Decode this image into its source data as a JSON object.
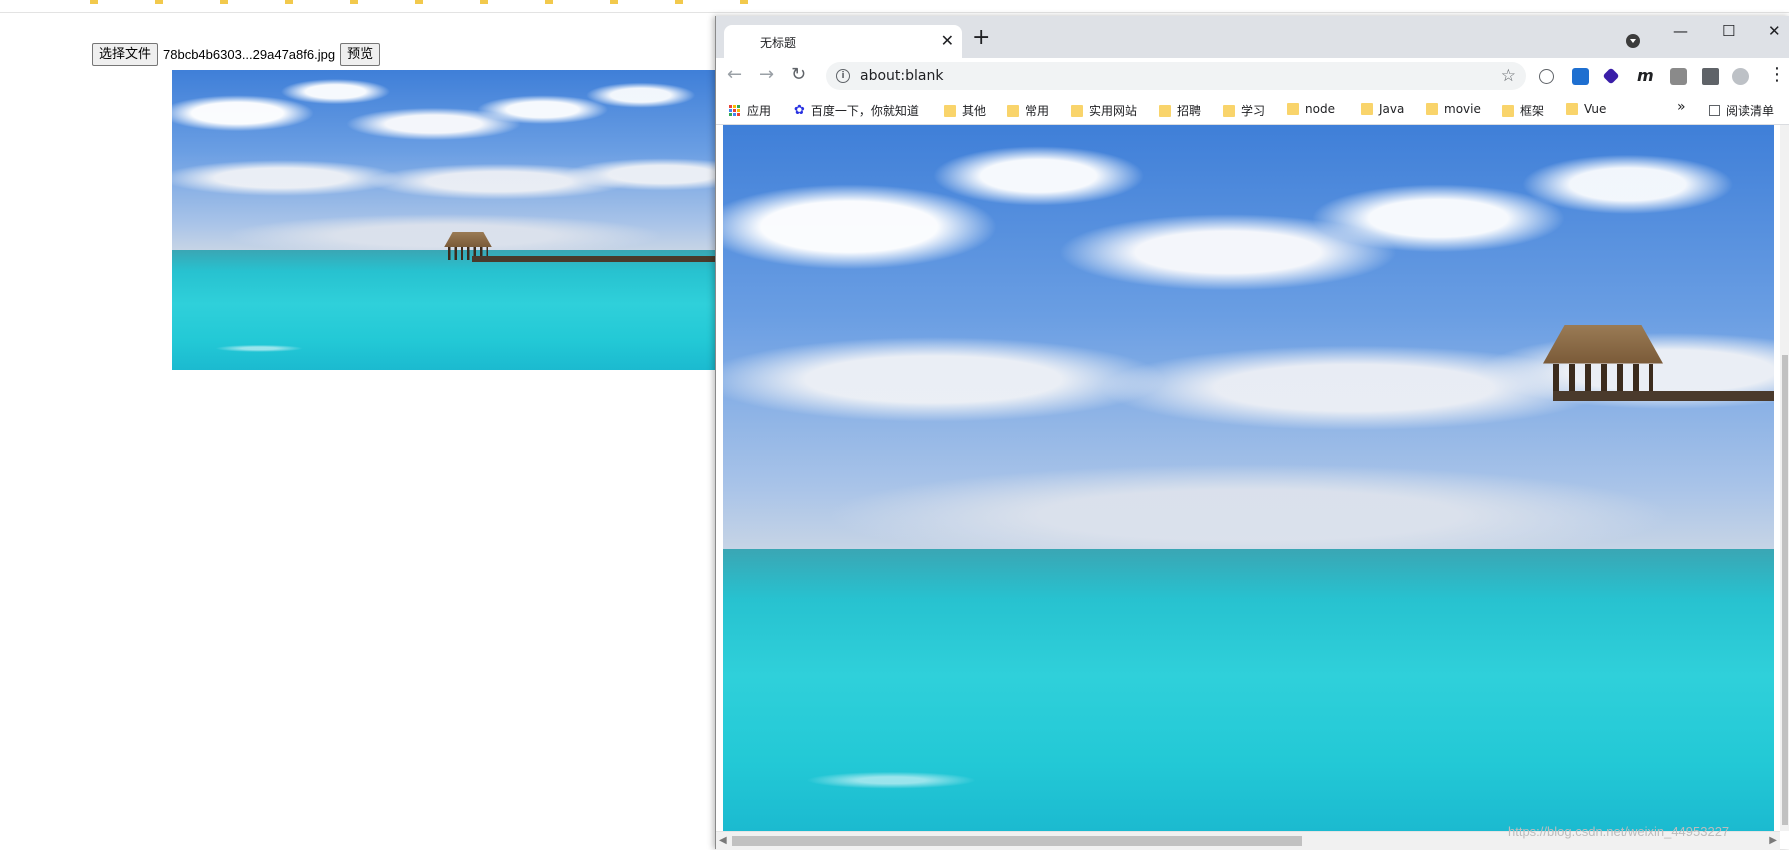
{
  "page": {
    "choose_file_label": "选择文件",
    "file_name": "78bcb4b6303...29a47a8f6.jpg",
    "preview_label": "预览"
  },
  "browser": {
    "tab_title": "无标题",
    "tab_close": "✕",
    "new_tab": "+",
    "minimize": "—",
    "maximize": "☐",
    "close": "✕",
    "back": "←",
    "forward": "→",
    "reload": "↻",
    "info_symbol": "i",
    "url": "about:blank",
    "star": "☆",
    "more": "⋮"
  },
  "bookmarks": {
    "apps": "应用",
    "baidu": "百度一下，你就知道",
    "items": [
      "其他",
      "常用",
      "实用网站",
      "招聘",
      "学习",
      "node",
      "Java",
      "movie",
      "框架",
      "Vue"
    ],
    "overflow": "»",
    "reading_list": "阅读清单"
  },
  "watermark": "https://blog.csdn.net/weixin_44953227",
  "colors": {
    "accent": "#1a73e8",
    "titlebar": "#dee1e6",
    "folder": "#f9d46b",
    "sea": "#2fd0da",
    "sky": "#6a9ee3"
  }
}
